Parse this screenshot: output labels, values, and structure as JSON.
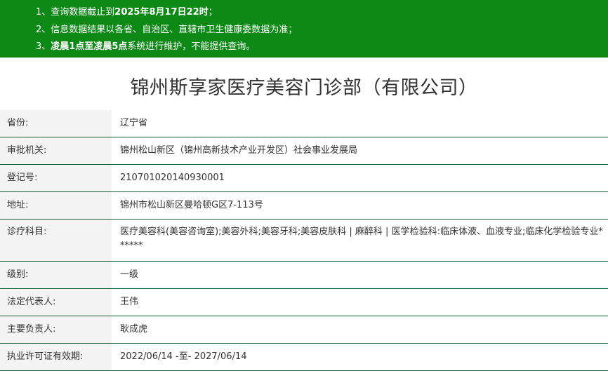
{
  "notice": {
    "lines": [
      {
        "prefix": "1、查询数据截止到",
        "bold": "2025年8月17日22时",
        "suffix": "；"
      },
      {
        "prefix": "2、信息数据结果以各省、自治区、直辖市卫生健康委数据为准；",
        "bold": "",
        "suffix": ""
      },
      {
        "prefix": "3、",
        "bold": "凌晨1点至凌晨5点",
        "suffix": "系统进行维护，不能提供查询。"
      }
    ]
  },
  "title": "锦州斯享家医疗美容门诊部（有限公司）",
  "fields": [
    {
      "label": "省份:",
      "value": "辽宁省"
    },
    {
      "label": "审批机关:",
      "value": "锦州松山新区（锦州高新技术产业开发区）社会事业发展局"
    },
    {
      "label": "登记号:",
      "value": "210701020140930001"
    },
    {
      "label": "地址:",
      "value": "锦州市松山新区曼哈顿G区7-113号"
    },
    {
      "label": "诊疗科目:",
      "value": "医疗美容科(美容咨询室);美容外科;美容牙科;美容皮肤科 | 麻醉科 | 医学检验科:临床体液、血液专业;临床化学检验专业******"
    },
    {
      "label": "级别:",
      "value": "一级"
    },
    {
      "label": "法定代表人:",
      "value": "王伟"
    },
    {
      "label": "主要负责人:",
      "value": "耿成虎"
    },
    {
      "label": "执业许可证有效期:",
      "value": "2022/06/14 -至- 2027/06/14"
    }
  ],
  "colors": {
    "notice_bg": "#0d8a16",
    "row_border": "#1a5c3a",
    "label_bg": "#f4f4f4"
  }
}
